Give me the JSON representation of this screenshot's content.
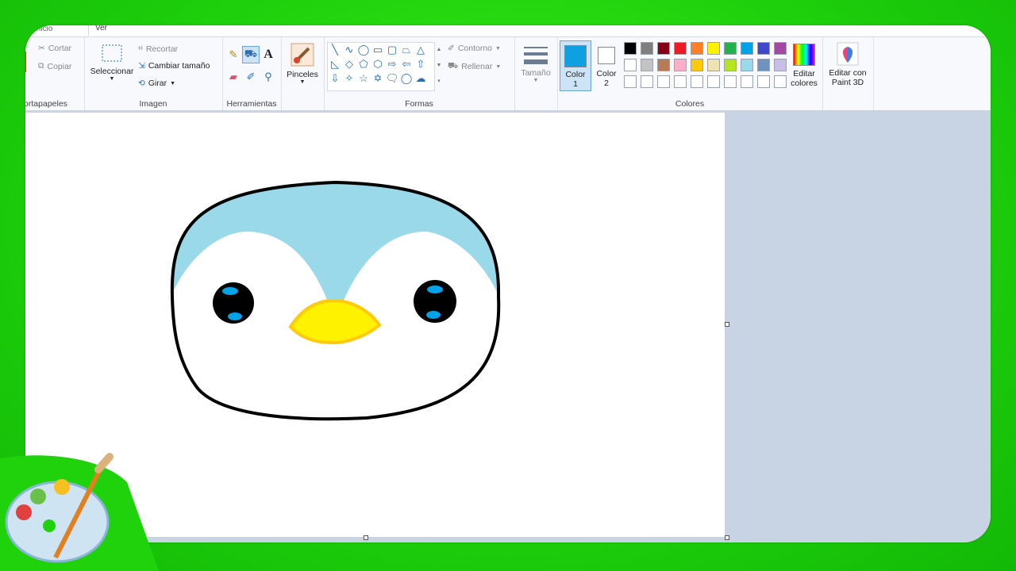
{
  "tabs": {
    "home": "Inicio",
    "view": "Ver"
  },
  "clipboard": {
    "cut": "Cortar",
    "copy": "Copiar",
    "label": "Portapapeles"
  },
  "image": {
    "select": "Seleccionar",
    "crop": "Recortar",
    "resize": "Cambiar tamaño",
    "rotate": "Girar",
    "label": "Imagen"
  },
  "tools": {
    "label": "Herramientas"
  },
  "brushes": {
    "label": "Pinceles"
  },
  "shapes": {
    "outline": "Contorno",
    "fill": "Rellenar",
    "label": "Formas"
  },
  "size": {
    "label": "Tamaño"
  },
  "color1": {
    "line1": "Color",
    "line2": "1",
    "value": "#0ea0e0"
  },
  "color2": {
    "line1": "Color",
    "line2": "2",
    "value": "#ffffff"
  },
  "colors": {
    "label": "Colores",
    "edit_line1": "Editar",
    "edit_line2": "colores",
    "row1": [
      "#000000",
      "#7f7f7f",
      "#880015",
      "#ed1c24",
      "#ff7f27",
      "#fff200",
      "#22b14c",
      "#00a2e8",
      "#3f48cc",
      "#a349a4"
    ],
    "row2": [
      "#ffffff",
      "#c3c3c3",
      "#b97a57",
      "#ffaec9",
      "#ffc90e",
      "#efe4b0",
      "#b5e61d",
      "#99d9ea",
      "#7092be",
      "#c8bfe7"
    ],
    "row3": [
      "#ffffff",
      "#ffffff",
      "#ffffff",
      "#ffffff",
      "#ffffff",
      "#ffffff",
      "#ffffff",
      "#ffffff",
      "#ffffff",
      "#ffffff"
    ]
  },
  "paint3d": {
    "line1": "Editar con",
    "line2": "Paint 3D"
  },
  "drawing": {
    "outline": "#000000",
    "head_top": "#99d9ea",
    "face": "#ffffff",
    "beak": "#fff200",
    "beak_outline": "#ffc90e",
    "eye": "#000000",
    "eye_highlight": "#00a2e8"
  }
}
